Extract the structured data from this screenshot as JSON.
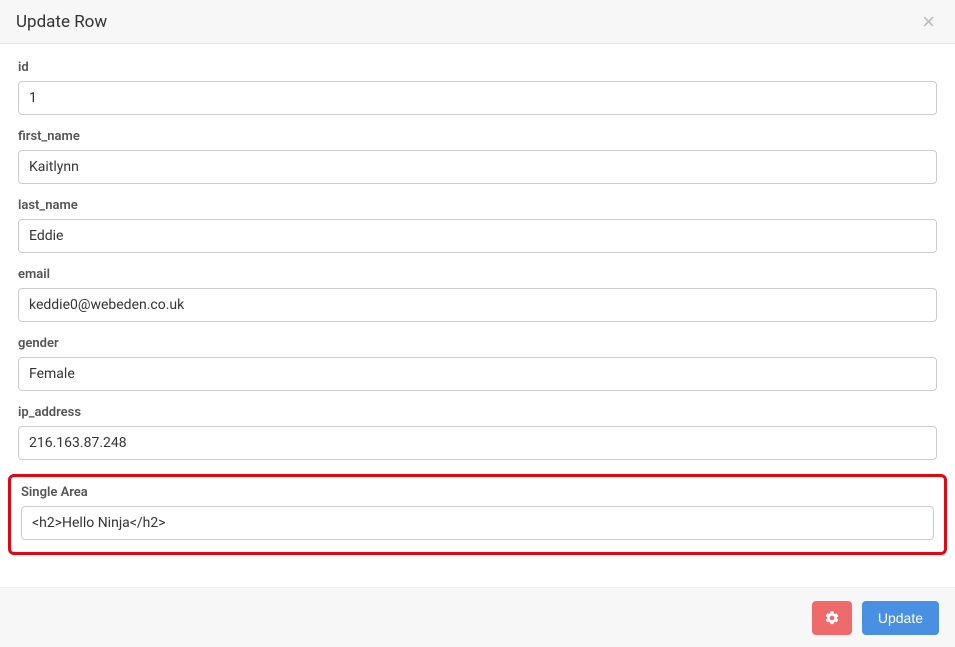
{
  "header": {
    "title": "Update Row"
  },
  "fields": {
    "id": {
      "label": "id",
      "value": "1"
    },
    "first_name": {
      "label": "first_name",
      "value": "Kaitlynn"
    },
    "last_name": {
      "label": "last_name",
      "value": "Eddie"
    },
    "email": {
      "label": "email",
      "value": "keddie0@webeden.co.uk"
    },
    "gender": {
      "label": "gender",
      "value": "Female"
    },
    "ip_address": {
      "label": "ip_address",
      "value": "216.163.87.248"
    },
    "single_area": {
      "label": "Single Area",
      "value": "<h2>Hello Ninja</h2>"
    }
  },
  "footer": {
    "update_label": "Update"
  }
}
